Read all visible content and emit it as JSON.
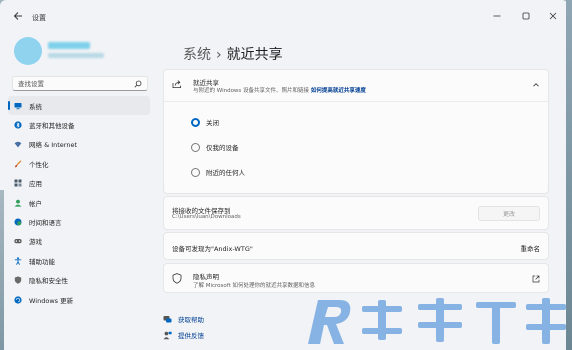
{
  "window": {
    "title": "设置"
  },
  "search": {
    "placeholder": "查找设置"
  },
  "nav": {
    "items": [
      {
        "label": "系统",
        "icon": "monitor-icon",
        "color": "#0067c0"
      },
      {
        "label": "蓝牙和其他设备",
        "icon": "bluetooth-icon",
        "color": "#0067c0"
      },
      {
        "label": "网络 & Internet",
        "icon": "network-icon",
        "color": "#4a6fa5"
      },
      {
        "label": "个性化",
        "icon": "brush-icon",
        "color": "#e08a2e"
      },
      {
        "label": "应用",
        "icon": "apps-icon",
        "color": "#4a5a6a"
      },
      {
        "label": "帐户",
        "icon": "account-icon",
        "color": "#2e9e5a"
      },
      {
        "label": "时间和语言",
        "icon": "globe-clock-icon",
        "color": "#0067c0"
      },
      {
        "label": "游戏",
        "icon": "gamepad-icon",
        "color": "#5a5a5a"
      },
      {
        "label": "辅助功能",
        "icon": "accessibility-icon",
        "color": "#0067c0"
      },
      {
        "label": "隐私和安全性",
        "icon": "shield-icon",
        "color": "#6a6a6a"
      },
      {
        "label": "Windows 更新",
        "icon": "update-icon",
        "color": "#0067c0"
      }
    ]
  },
  "header": {
    "parent": "系统",
    "separator": "›",
    "title": "就近共享"
  },
  "nearby": {
    "title": "就近共享",
    "desc_prefix": "与附近的 Windows 设备共享文件、照片和链接",
    "desc_link": "如何提高就近共享速度",
    "options": [
      {
        "label": "关闭",
        "checked": true
      },
      {
        "label": "仅我的设备",
        "checked": false
      },
      {
        "label": "附近的任何人",
        "checked": false
      }
    ]
  },
  "save": {
    "title": "将接收的文件保存到",
    "path": "C:\\Users\\luan\\Downloads",
    "button": "更改"
  },
  "discover": {
    "label": "设备可发现为\"Andix-WTG\"",
    "rename": "重命名"
  },
  "privacy": {
    "title": "隐私声明",
    "desc": "了解 Microsoft 如何处理你的就近共享数据和信息"
  },
  "help": {
    "get_help": "获取帮助",
    "feedback": "提供反馈"
  },
  "colors": {
    "accent": "#0067c0",
    "link": "#003e92"
  }
}
